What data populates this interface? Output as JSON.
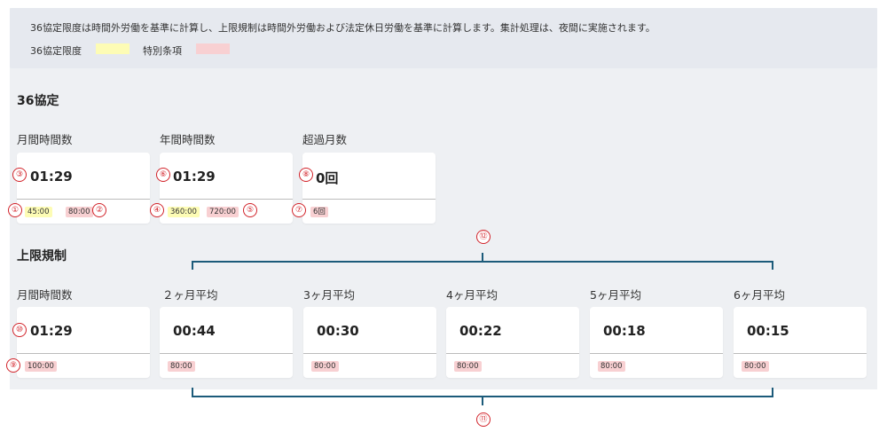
{
  "notice": {
    "text": "36協定限度は時間外労働を基準に計算し、上限規制は時間外労働および法定休日労働を基準に計算します。集計処理は、夜間に実施されます。",
    "legend": [
      {
        "label": "36協定限度",
        "color": "#fdfcb5"
      },
      {
        "label": "特別条項",
        "color": "#f8d0d2"
      }
    ]
  },
  "agreement36": {
    "title": "36協定",
    "cards": [
      {
        "label": "月間時間数",
        "value": "01:29",
        "badges": [
          "45:00",
          "80:00"
        ]
      },
      {
        "label": "年間時間数",
        "value": "01:29",
        "badges": [
          "360:00",
          "720:00"
        ]
      },
      {
        "label": "超過月数",
        "value": "0回",
        "badges": [
          "6回"
        ]
      }
    ]
  },
  "upper_limit": {
    "title": "上限規制",
    "cards": [
      {
        "label": "月間時間数",
        "value": "01:29",
        "badges": [
          "100:00"
        ]
      },
      {
        "label": "２ヶ月平均",
        "value": "00:44",
        "badges": [
          "80:00"
        ]
      },
      {
        "label": "3ヶ月平均",
        "value": "00:30",
        "badges": [
          "80:00"
        ]
      },
      {
        "label": "4ヶ月平均",
        "value": "00:22",
        "badges": [
          "80:00"
        ]
      },
      {
        "label": "5ヶ月平均",
        "value": "00:18",
        "badges": [
          "80:00"
        ]
      },
      {
        "label": "6ヶ月平均",
        "value": "00:15",
        "badges": [
          "80:00"
        ]
      }
    ]
  },
  "annotations": [
    "①",
    "②",
    "③",
    "④",
    "⑤",
    "⑥",
    "⑦",
    "⑧",
    "⑨",
    "⑩",
    "⑪",
    "⑫"
  ],
  "colors": {
    "annotation": "#d2232a",
    "bracket": "#1c5b7a",
    "limit_yellow": "#fdfcb5",
    "limit_red": "#f8d0d2"
  }
}
